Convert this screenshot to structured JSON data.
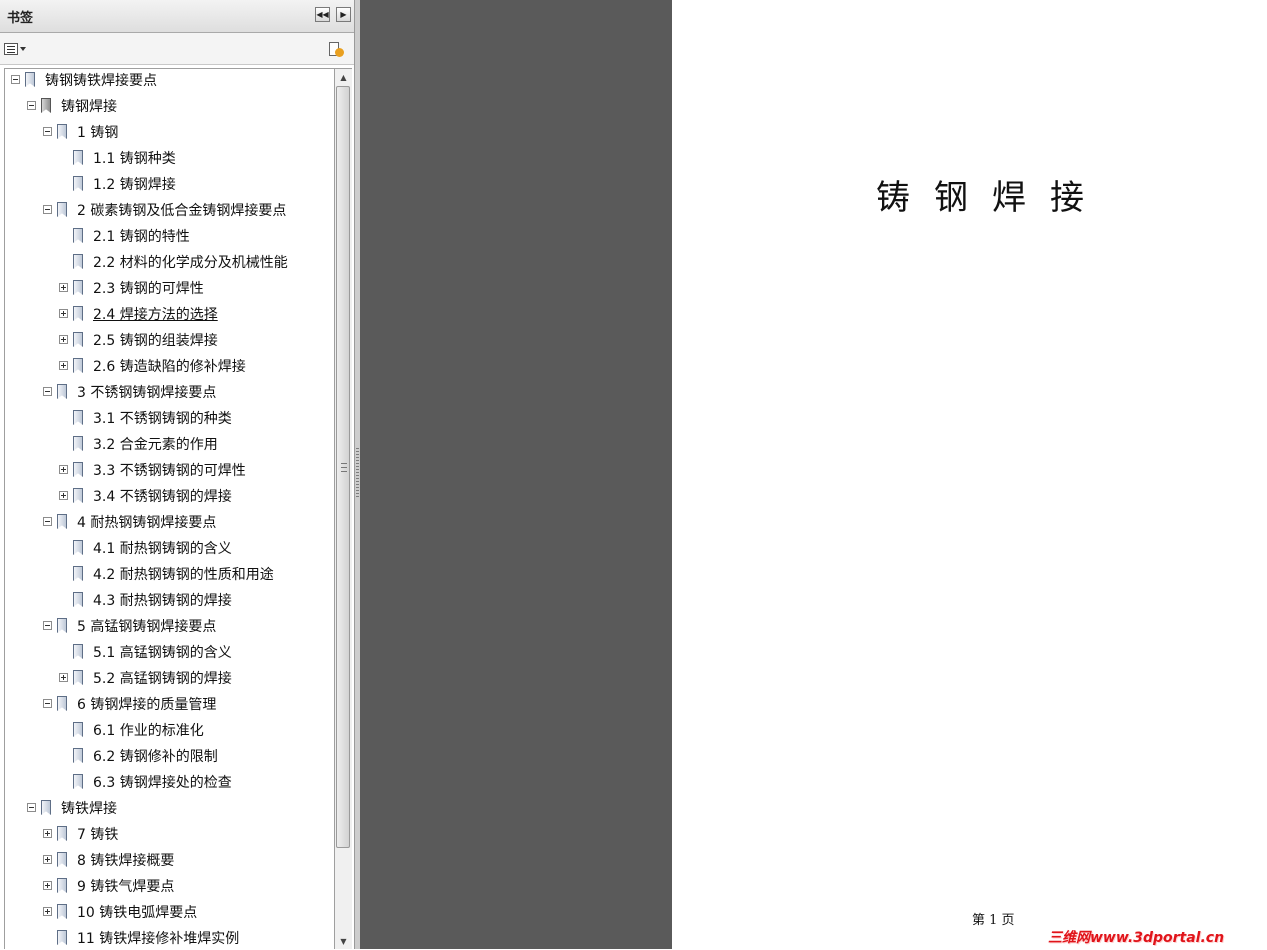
{
  "panel": {
    "title": "书签",
    "collapse_icon": "double-left-arrow",
    "next_icon": "right-arrow",
    "options_icon": "list-options",
    "new_bookmark_icon": "new-bookmark"
  },
  "bookmarks": [
    {
      "level": 0,
      "toggle": "minus",
      "icon": "blue",
      "label": "铸钢铸铁焊接要点"
    },
    {
      "level": 1,
      "toggle": "minus",
      "icon": "gray",
      "label": "铸钢焊接"
    },
    {
      "level": 2,
      "toggle": "minus",
      "icon": "blue",
      "label": "1  铸钢"
    },
    {
      "level": 3,
      "toggle": "none",
      "icon": "blue",
      "label": "1.1  铸钢种类"
    },
    {
      "level": 3,
      "toggle": "none",
      "icon": "blue",
      "label": "1.2  铸钢焊接"
    },
    {
      "level": 2,
      "toggle": "minus",
      "icon": "blue",
      "label": "2  碳素铸钢及低合金铸钢焊接要点"
    },
    {
      "level": 3,
      "toggle": "none",
      "icon": "blue",
      "label": "2.1  铸钢的特性"
    },
    {
      "level": 3,
      "toggle": "none",
      "icon": "blue",
      "label": "2.2  材料的化学成分及机械性能"
    },
    {
      "level": 3,
      "toggle": "plus",
      "icon": "blue",
      "label": "2.3  铸钢的可焊性"
    },
    {
      "level": 3,
      "toggle": "plus",
      "icon": "blue",
      "label": "2.4  焊接方法的选择",
      "selected": true
    },
    {
      "level": 3,
      "toggle": "plus",
      "icon": "blue",
      "label": "2.5  铸钢的组装焊接"
    },
    {
      "level": 3,
      "toggle": "plus",
      "icon": "blue",
      "label": "2.6  铸造缺陷的修补焊接"
    },
    {
      "level": 2,
      "toggle": "minus",
      "icon": "blue",
      "label": "3  不锈钢铸钢焊接要点"
    },
    {
      "level": 3,
      "toggle": "none",
      "icon": "blue",
      "label": "3.1  不锈钢铸钢的种类"
    },
    {
      "level": 3,
      "toggle": "none",
      "icon": "blue",
      "label": "3.2  合金元素的作用"
    },
    {
      "level": 3,
      "toggle": "plus",
      "icon": "blue",
      "label": "3.3  不锈钢铸钢的可焊性"
    },
    {
      "level": 3,
      "toggle": "plus",
      "icon": "blue",
      "label": "3.4  不锈钢铸钢的焊接"
    },
    {
      "level": 2,
      "toggle": "minus",
      "icon": "blue",
      "label": "4  耐热钢铸钢焊接要点"
    },
    {
      "level": 3,
      "toggle": "none",
      "icon": "blue",
      "label": "4.1  耐热钢铸钢的含义"
    },
    {
      "level": 3,
      "toggle": "none",
      "icon": "blue",
      "label": "4.2  耐热钢铸钢的性质和用途"
    },
    {
      "level": 3,
      "toggle": "none",
      "icon": "blue",
      "label": "4.3  耐热钢铸钢的焊接"
    },
    {
      "level": 2,
      "toggle": "minus",
      "icon": "blue",
      "label": "5  高锰钢铸钢焊接要点"
    },
    {
      "level": 3,
      "toggle": "none",
      "icon": "blue",
      "label": "5.1  高锰钢铸钢的含义"
    },
    {
      "level": 3,
      "toggle": "plus",
      "icon": "blue",
      "label": "5.2  高锰钢铸钢的焊接"
    },
    {
      "level": 2,
      "toggle": "minus",
      "icon": "blue",
      "label": "6  铸钢焊接的质量管理"
    },
    {
      "level": 3,
      "toggle": "none",
      "icon": "blue",
      "label": "6.1  作业的标准化"
    },
    {
      "level": 3,
      "toggle": "none",
      "icon": "blue",
      "label": "6.2  铸钢修补的限制"
    },
    {
      "level": 3,
      "toggle": "none",
      "icon": "blue",
      "label": "6.3  铸钢焊接处的检查"
    },
    {
      "level": 1,
      "toggle": "minus",
      "icon": "blue",
      "label": "铸铁焊接"
    },
    {
      "level": 2,
      "toggle": "plus",
      "icon": "blue",
      "label": "7  铸铁"
    },
    {
      "level": 2,
      "toggle": "plus",
      "icon": "blue",
      "label": "8  铸铁焊接概要"
    },
    {
      "level": 2,
      "toggle": "plus",
      "icon": "blue",
      "label": "9  铸铁气焊要点"
    },
    {
      "level": 2,
      "toggle": "plus",
      "icon": "blue",
      "label": "10  铸铁电弧焊要点"
    },
    {
      "level": 2,
      "toggle": "none",
      "icon": "blue",
      "label": "11  铸铁焊接修补堆焊实例"
    }
  ],
  "page": {
    "heading": "铸钢焊接",
    "footer": "第  1  页"
  },
  "watermark": "三维网www.3dportal.cn",
  "colors": {
    "viewer_background": "#5a5a5a",
    "page_background": "#ffffff",
    "watermark": "#e0141a"
  }
}
